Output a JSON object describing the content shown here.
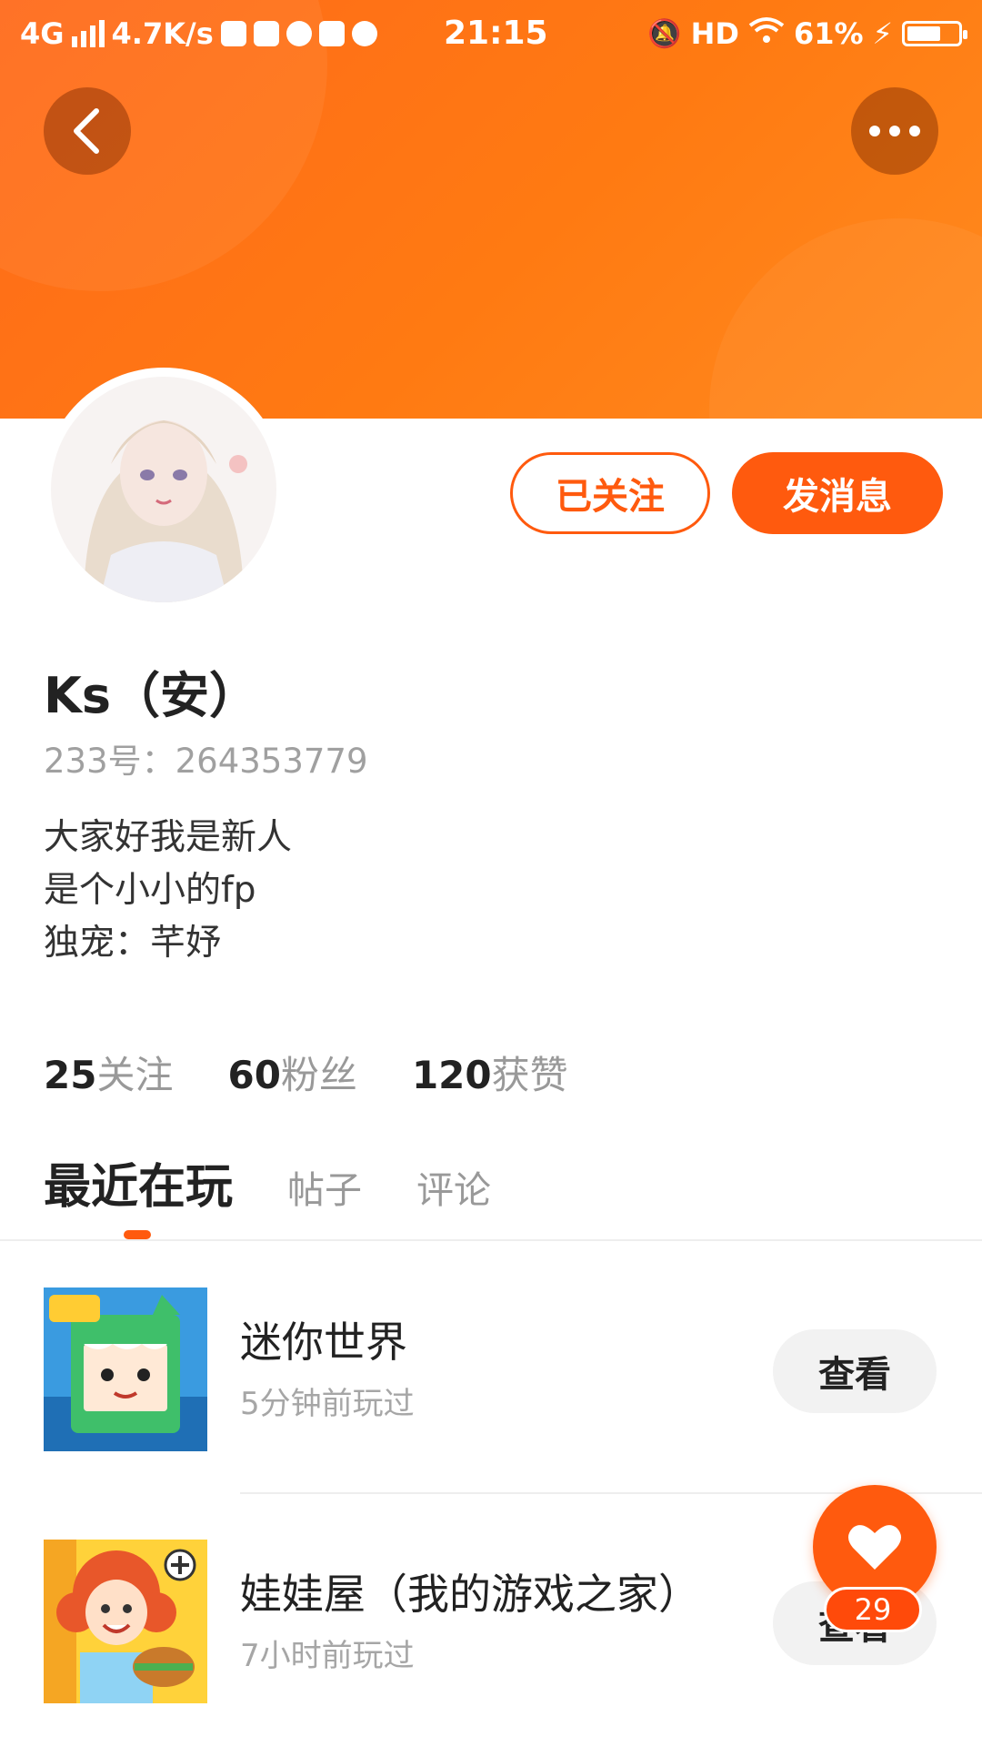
{
  "status_bar": {
    "network": "4G",
    "speed": "4.7K/s",
    "time": "21:15",
    "hd": "HD",
    "battery": "61%"
  },
  "header": {
    "back_icon": "chevron-left-icon",
    "more_icon": "more-dots-icon"
  },
  "profile": {
    "follow_label": "已关注",
    "message_label": "发消息",
    "name": "Ks（安）",
    "id_text": "233号：264353779",
    "bio": [
      "大家好我是新人",
      "是个小小的fp",
      "独宠：芊妤"
    ]
  },
  "stats": [
    {
      "num": "25",
      "label": "关注"
    },
    {
      "num": "60",
      "label": "粉丝"
    },
    {
      "num": "120",
      "label": "获赞"
    }
  ],
  "tabs": [
    {
      "label": "最近在玩",
      "active": true
    },
    {
      "label": "帖子",
      "active": false
    },
    {
      "label": "评论",
      "active": false
    }
  ],
  "games": [
    {
      "name": "迷你世界",
      "time": "5分钟前玩过",
      "button": "查看"
    },
    {
      "name": "娃娃屋（我的游戏之家）",
      "time": "7小时前玩过",
      "button": "查看"
    }
  ],
  "like": {
    "icon": "heart-icon",
    "count": "29"
  },
  "colors": {
    "accent": "#ff5a0e",
    "banner": "#ff7a12"
  }
}
